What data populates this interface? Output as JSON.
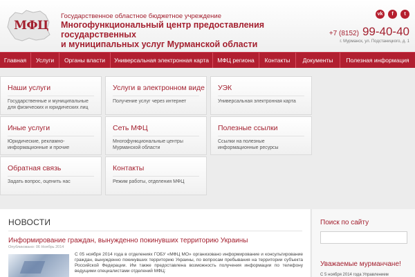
{
  "header": {
    "logo_text": "МФЦ",
    "org_subtitle": "Государственное областное бюджетное учреждение",
    "org_title_line1": "Многофункциональный центр предоставления государственных",
    "org_title_line2": "и муниципальных услуг Мурманской области",
    "phone_code": "+7 (8152)",
    "phone_number": "99-40-40",
    "address": "г. Мурманск, ул. Подстаницкого, д. 1",
    "socials": [
      {
        "icon": "vk-icon",
        "glyph": "vk"
      },
      {
        "icon": "facebook-icon",
        "glyph": "f"
      },
      {
        "icon": "twitter-icon",
        "glyph": "t"
      }
    ]
  },
  "nav": {
    "items": [
      {
        "label": "Главная"
      },
      {
        "label": "Услуги"
      },
      {
        "label": "Органы власти"
      },
      {
        "label": "Универсальная электронная карта"
      },
      {
        "label": "МФЦ региона"
      },
      {
        "label": "Контакты"
      },
      {
        "label": "Документы"
      },
      {
        "label": "Полезная информация"
      }
    ]
  },
  "tiles": [
    {
      "title": "Наши услуги",
      "desc": "Государственные и муниципальные для физических и юридических лиц"
    },
    {
      "title": "Услуги в электронном виде",
      "desc": "Получение услуг через интернет"
    },
    {
      "title": "УЭК",
      "desc": "Универсальная электронная карта"
    },
    {
      "title": "Иные услуги",
      "desc": "Юридические, рекламно-информационные и прочие"
    },
    {
      "title": "Сеть МФЦ",
      "desc": "Многофункциональные центры Мурманской области"
    },
    {
      "title": "Полезные ссылки",
      "desc": "Ссылки на полезные информационные ресурсы"
    },
    {
      "title": "Обратная связь",
      "desc": "Задать вопрос, оценить нас"
    },
    {
      "title": "Контакты",
      "desc": "Режим работы, отделения МФЦ"
    }
  ],
  "news": {
    "heading": "НОВОСТИ",
    "item_title": "Информирование граждан, вынужденно покинувших территорию Украины",
    "item_date": "Опубликовано: 06 Ноябрь 2014",
    "item_text": "С 05 ноября 2014 года в отделениях ГОБУ «МФЦ МО» организовано информирование и консультирование граждан, вынужденно покинувших территорию Украины, по вопросам пребывания на территории субъекта Российской Федерации. Им также предоставлена возможность получения информации по телефону ведущими специалистами отделений МФЦ:"
  },
  "sidebar": {
    "search_title": "Поиск по сайту",
    "greeting_title": "Уважаемые мурманчане!",
    "greeting_text": "С 5 ноября 2014 года Управлением"
  },
  "colors": {
    "accent": "#a31f2e",
    "nav_bg": "#b11f30"
  }
}
